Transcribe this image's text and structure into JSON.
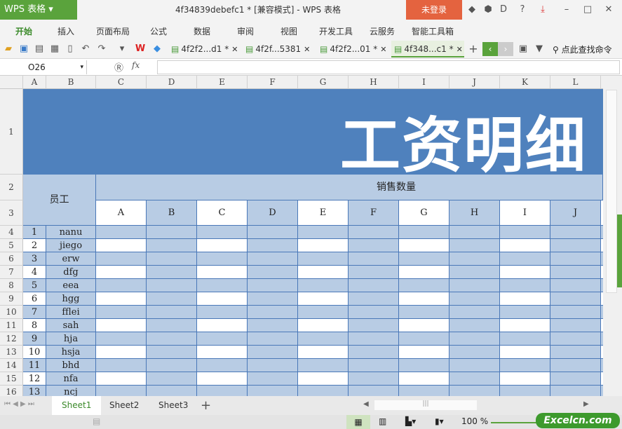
{
  "app": {
    "name": "WPS 表格",
    "doc_title": "4f34839debefc1 * [兼容模式] - WPS 表格",
    "login": "未登录"
  },
  "menu": [
    "开始",
    "插入",
    "页面布局",
    "公式",
    "数据",
    "审阅",
    "视图",
    "开发工具",
    "云服务",
    "智能工具箱"
  ],
  "doc_tabs": [
    {
      "label": "4f2f2...d1 *",
      "active": false
    },
    {
      "label": "4f2f...5381",
      "active": false
    },
    {
      "label": "4f2f2...01 *",
      "active": false
    },
    {
      "label": "4f348...c1 *",
      "active": true
    }
  ],
  "search_cmd": "点此查找命令",
  "formula": {
    "name_box": "O26",
    "fx": "fx",
    "value": ""
  },
  "columns": [
    "A",
    "B",
    "C",
    "D",
    "E",
    "F",
    "G",
    "H",
    "I",
    "J",
    "K",
    "L"
  ],
  "sheet": {
    "title": "工资明细",
    "group_header": "销售数量",
    "employee_header": "员工",
    "sub_headers": [
      "A",
      "B",
      "C",
      "D",
      "E",
      "F",
      "G",
      "H",
      "I",
      "J"
    ],
    "rows": [
      [
        "1",
        "nanu"
      ],
      [
        "2",
        "jiego"
      ],
      [
        "3",
        "erw"
      ],
      [
        "4",
        "dfg"
      ],
      [
        "5",
        "eea"
      ],
      [
        "6",
        "hgg"
      ],
      [
        "7",
        "fflei"
      ],
      [
        "8",
        "sah"
      ],
      [
        "9",
        "hja"
      ],
      [
        "10",
        "hsja"
      ],
      [
        "11",
        "bhd"
      ],
      [
        "12",
        "nfa"
      ],
      [
        "13",
        "ncj"
      ]
    ]
  },
  "row_numbers": [
    "1",
    "2",
    "3",
    "4",
    "5",
    "6",
    "7",
    "8",
    "9",
    "10",
    "11",
    "12",
    "13",
    "14",
    "15",
    "16"
  ],
  "sheet_tabs": [
    {
      "label": "Sheet1",
      "active": true
    },
    {
      "label": "Sheet2",
      "active": false
    },
    {
      "label": "Sheet3",
      "active": false
    }
  ],
  "status": {
    "zoom": "100 %",
    "watermark": "Excelcn.com"
  },
  "colors": {
    "banner": "#4f81bd",
    "cell_blue": "#b8cce4",
    "accent": "#5aa33c",
    "login": "#e4633f"
  }
}
